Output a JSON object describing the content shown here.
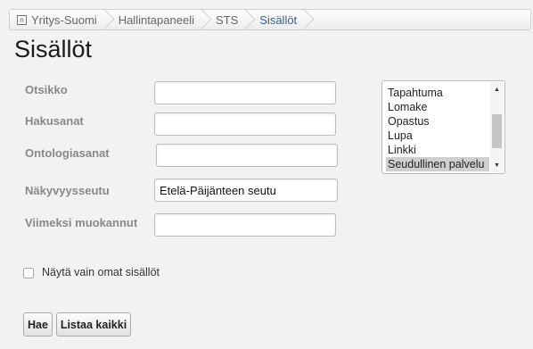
{
  "breadcrumb": {
    "items": [
      {
        "label": "Yritys-Suomi",
        "icon": "home-icon"
      },
      {
        "label": "Hallintapaneeli"
      },
      {
        "label": "STS"
      },
      {
        "label": "Sisällöt"
      }
    ],
    "active_color": "#3a5f8a"
  },
  "page": {
    "title": "Sisällöt"
  },
  "form": {
    "otsikko_label": "Otsikko",
    "otsikko_value": "",
    "hakusanat_label": "Hakusanat",
    "hakusanat_value": "",
    "ontologiasanat_label": "Ontologiasanat",
    "ontologiasanat_value": "",
    "nakyvyysseutu_label": "Näkyvyysseutu",
    "nakyvyysseutu_value": "Etelä-Päijänteen seutu",
    "viimeksi_label": "Viimeksi muokannut",
    "viimeksi_value": ""
  },
  "type_list": {
    "options": [
      "Tapahtuma",
      "Lomake",
      "Opastus",
      "Lupa",
      "Linkki",
      "Seudullinen palvelu"
    ],
    "selected": "Seudullinen palvelu"
  },
  "own_only": {
    "label": "Näytä vain omat sisällöt",
    "checked": false
  },
  "buttons": {
    "search": "Hae",
    "list_all": "Listaa kaikki"
  }
}
